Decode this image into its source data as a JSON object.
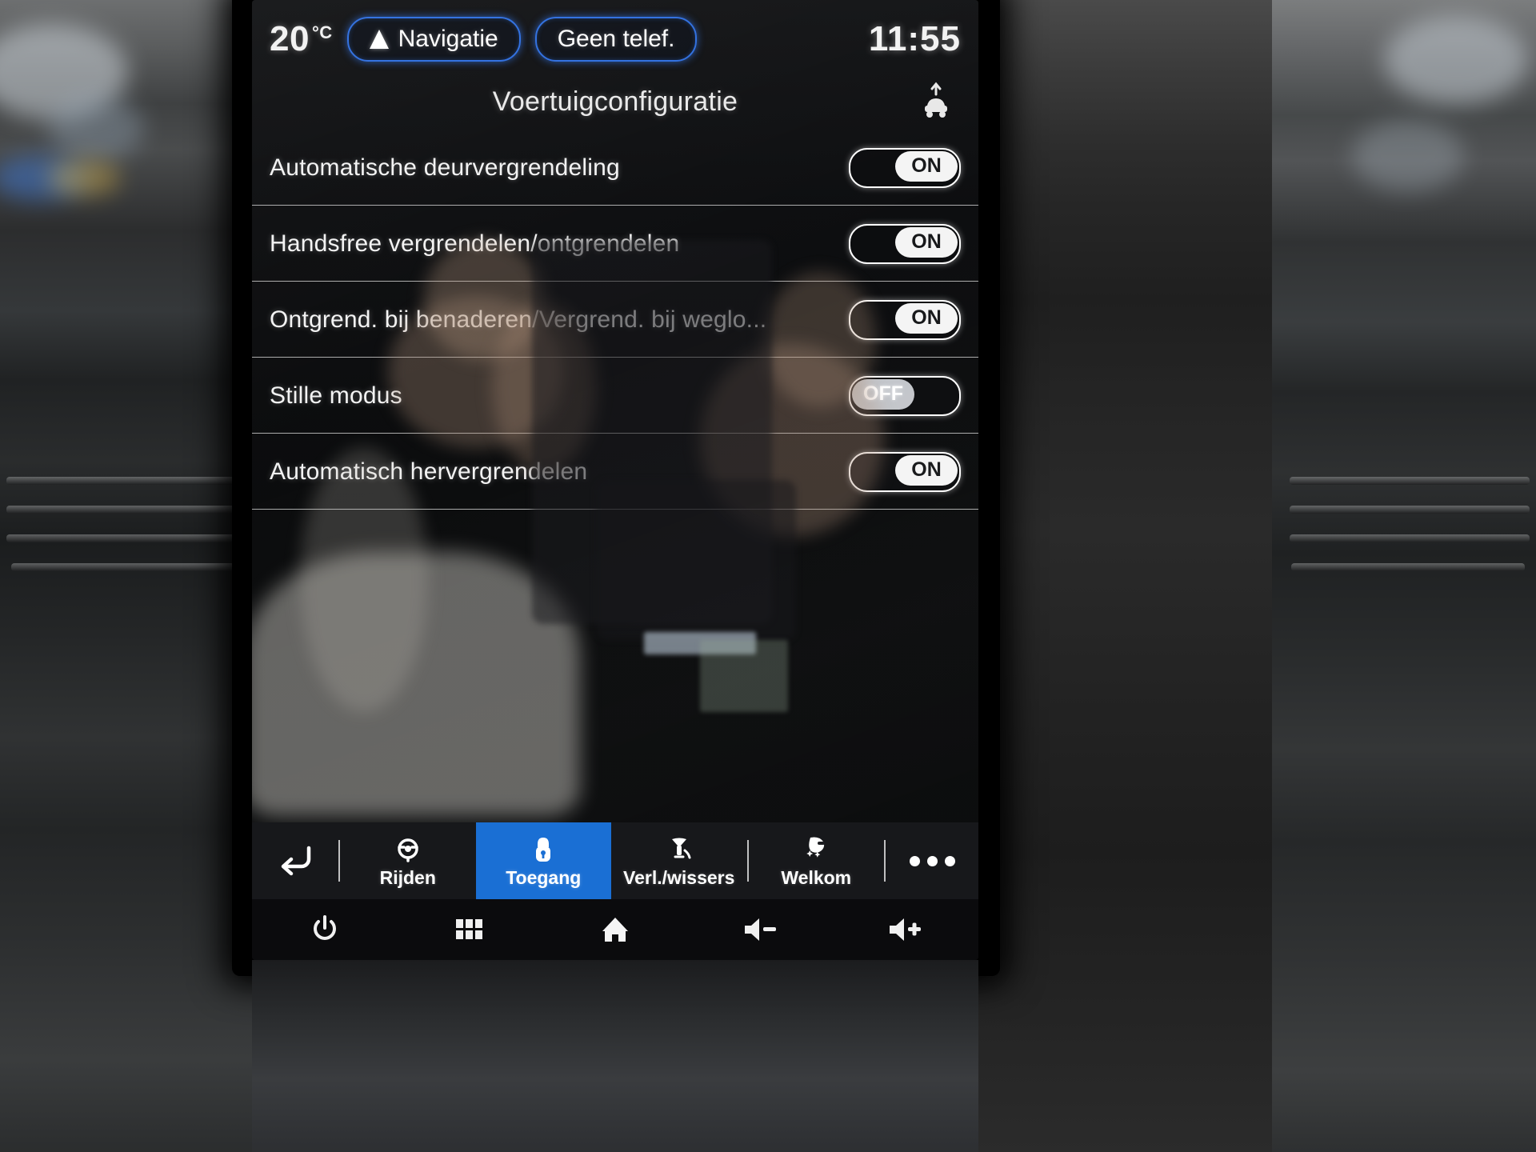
{
  "statusbar": {
    "temperature": "20",
    "temperature_unit": "°C",
    "navigation_label": "Navigatie",
    "navigation_icon": "navigation-arrow-icon",
    "phone_label": "Geen telef.",
    "clock": "11:55"
  },
  "header": {
    "title": "Voertuigconfiguratie",
    "vehicle_icon": "vehicle-profile-icon"
  },
  "settings": {
    "rows": [
      {
        "label": "Automatische deurvergrendeling",
        "value": "ON",
        "state": "on"
      },
      {
        "label": "Handsfree vergrendelen/ontgrendelen",
        "value": "ON",
        "state": "on"
      },
      {
        "label": "Ontgrend. bij benaderen/Vergrend. bij weglo...",
        "value": "ON",
        "state": "on"
      },
      {
        "label": "Stille modus",
        "value": "OFF",
        "state": "off"
      },
      {
        "label": "Automatisch hervergrendelen",
        "value": "ON",
        "state": "on"
      }
    ]
  },
  "tabbar": {
    "back_icon": "back-arrow-icon",
    "tabs": [
      {
        "label": "Rijden",
        "icon": "steering-wheel-icon",
        "active": false
      },
      {
        "label": "Toegang",
        "icon": "door-lock-icon",
        "active": true
      },
      {
        "label": "Verl./wissers",
        "icon": "headlight-wiper-icon",
        "active": false
      },
      {
        "label": "Welkom",
        "icon": "welcome-lighting-icon",
        "active": false
      }
    ],
    "more_icon": "more-dots-icon"
  },
  "hardware_bar": {
    "buttons": [
      {
        "icon": "power-icon"
      },
      {
        "icon": "apps-grid-icon"
      },
      {
        "icon": "home-icon"
      },
      {
        "icon": "volume-down-icon"
      },
      {
        "icon": "volume-up-icon"
      }
    ]
  },
  "colors": {
    "accent_blue": "#1a6fd4",
    "pill_border_blue": "#2f6fe0",
    "screen_background": "#0b0c0e",
    "toggle_on_knob": "#f4f4f4",
    "toggle_off_knob": "#c3c6cb"
  }
}
